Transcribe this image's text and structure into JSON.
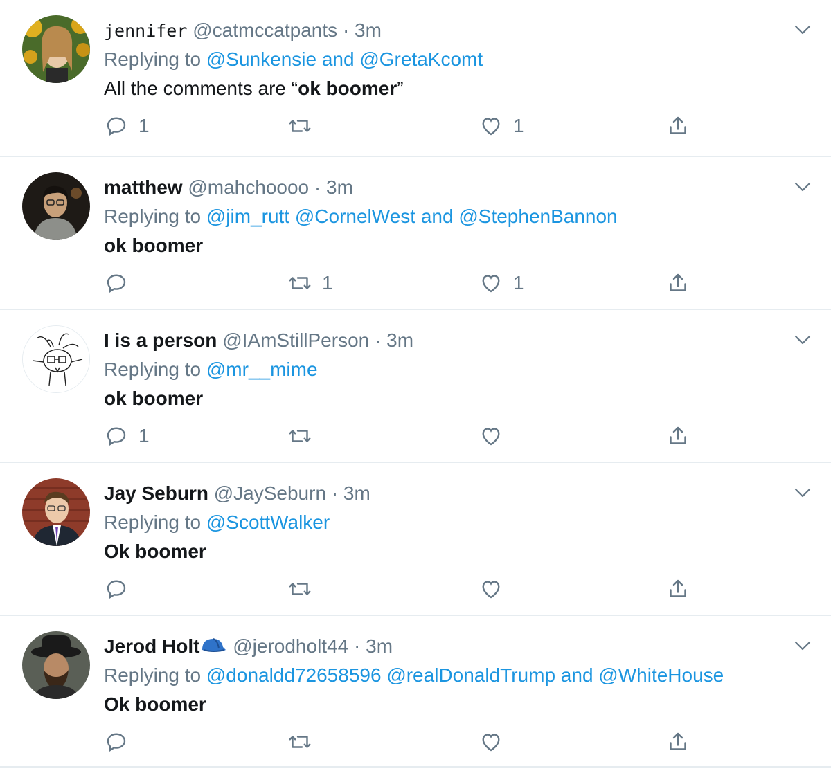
{
  "colors": {
    "text": "#14171a",
    "secondary": "#657786",
    "link": "#1b95e0",
    "divider": "#e6ecf0"
  },
  "tweets": [
    {
      "name": "jennifer",
      "handle": "@catmccatpants",
      "separator": "·",
      "time": "3m",
      "replying_prefix": "Replying to",
      "replying_to": [
        "@Sunkensie",
        "@GretaKcomt"
      ],
      "connector": "and",
      "text_pre": "All the comments are “",
      "text_bold": "ok boomer",
      "text_post": "”",
      "reply_count": "1",
      "retweet_count": "",
      "like_count": "1",
      "avatar_icon": "avatar-photo-woman-sunflowers"
    },
    {
      "name": "matthew",
      "handle": "@mahchoooo",
      "separator": "·",
      "time": "3m",
      "replying_prefix": "Replying to",
      "replying_to": [
        "@jim_rutt",
        "@CornelWest",
        "@StephenBannon"
      ],
      "connector": "and",
      "text_bold": "ok boomer",
      "reply_count": "",
      "retweet_count": "1",
      "like_count": "1",
      "avatar_icon": "avatar-photo-man-glasses"
    },
    {
      "name": "I is a person",
      "handle": "@IAmStillPerson",
      "separator": "·",
      "time": "3m",
      "replying_prefix": "Replying to",
      "replying_to": [
        "@mr__mime"
      ],
      "text_bold": "ok boomer",
      "reply_count": "1",
      "retweet_count": "",
      "like_count": "",
      "avatar_icon": "avatar-sketch-creature"
    },
    {
      "name": "Jay Seburn",
      "handle": "@JaySeburn",
      "separator": "·",
      "time": "3m",
      "replying_prefix": "Replying to",
      "replying_to": [
        "@ScottWalker"
      ],
      "text_bold": "Ok boomer",
      "reply_count": "",
      "retweet_count": "",
      "like_count": "",
      "avatar_icon": "avatar-photo-man-suit"
    },
    {
      "name": "Jerod Holt",
      "name_emoji": "cap-emoji-icon",
      "handle": "@jerodholt44",
      "separator": "·",
      "time": "3m",
      "replying_prefix": "Replying to",
      "replying_to": [
        "@donaldd72658596",
        "@realDonaldTrump",
        "@WhiteHouse"
      ],
      "connector": "and",
      "text_bold": "Ok boomer",
      "reply_count": "",
      "retweet_count": "",
      "like_count": "",
      "avatar_icon": "avatar-photo-man-hat"
    }
  ]
}
